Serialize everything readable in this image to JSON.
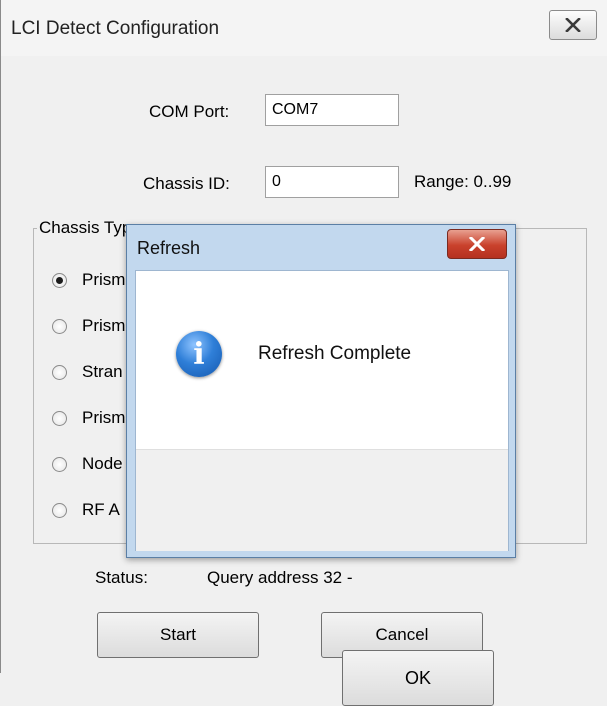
{
  "window": {
    "title": "LCI Detect Configuration"
  },
  "form": {
    "com_port_label": "COM Port:",
    "com_port_value": "COM7",
    "chassis_id_label": "Chassis ID:",
    "chassis_id_value": "0",
    "range_text": "Range: 0..99"
  },
  "chassis_type": {
    "legend": "Chassis Type",
    "options": [
      {
        "label": "Prism",
        "selected": true
      },
      {
        "label": "Prism",
        "selected": false
      },
      {
        "label": "Stran",
        "selected": false
      },
      {
        "label": "Prism",
        "selected": false
      },
      {
        "label": "Node",
        "selected": false
      },
      {
        "label": "RF A",
        "selected": false
      }
    ]
  },
  "status": {
    "label": "Status:",
    "value": "Query address 32 -"
  },
  "buttons": {
    "start": "Start",
    "cancel": "Cancel"
  },
  "modal": {
    "title": "Refresh",
    "message": "Refresh Complete",
    "ok": "OK",
    "info_glyph": "i",
    "close_glyph": "✕"
  },
  "icons": {
    "parent_close": "close-icon",
    "modal_close": "close-icon",
    "info": "info-icon"
  },
  "colors": {
    "modal_frame": "#c2d8ee",
    "modal_close": "#c9412c",
    "info_icon": "#2f7fd8"
  }
}
